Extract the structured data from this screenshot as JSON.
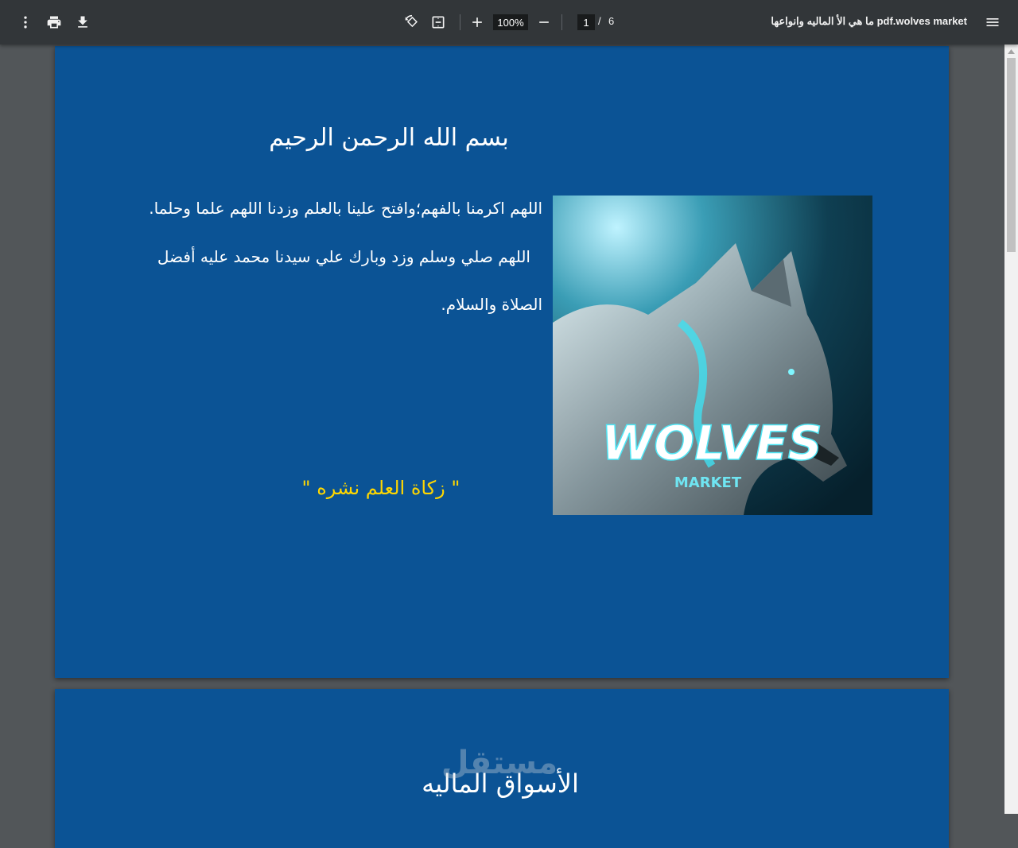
{
  "toolbar": {
    "title": "ما هي الأ الماليه وانواعها pdf.wolves market",
    "zoom": "100%",
    "current_page": "1",
    "page_separator": "/",
    "total_pages": "6",
    "icons": [
      "menu-icon",
      "rotate-icon",
      "fit-page-icon",
      "zoom-in-icon",
      "zoom-out-icon",
      "print-icon",
      "download-icon",
      "more-options-icon"
    ]
  },
  "page1": {
    "heading": "بسم الله الرحمن الرحيم",
    "line1": "اللهم اكرمنا بالفهم؛وافتح علينا بالعلم وزدنا اللهم علما وحلما.",
    "line2": "اللهم صلي وسلم وزد وبارك علي سيدنا محمد عليه أفضل",
    "line3": "الصلاة والسلام.",
    "quote": "\" زكاة العلم نشره \"",
    "image": {
      "logo_word": "WOLVES",
      "logo_sub": "MARKET"
    },
    "background": "#0b5395",
    "quote_color": "#ffd700"
  },
  "page2": {
    "heading": "الأسواق الماليه"
  },
  "watermark": {
    "text": "مستقل"
  }
}
